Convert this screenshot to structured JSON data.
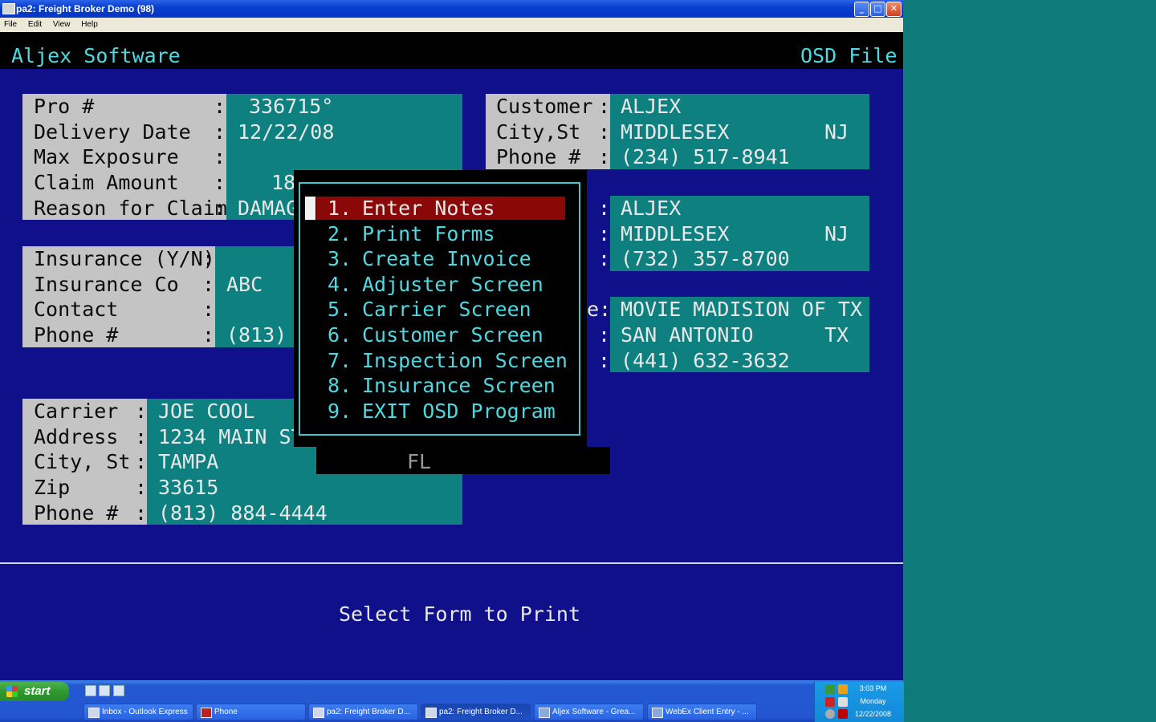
{
  "window": {
    "title": "pa2: Freight Broker Demo (98)",
    "menu": [
      "File",
      "Edit",
      "View",
      "Help"
    ],
    "minimize_glyph": "_",
    "maximize_glyph": "□",
    "close_glyph": "✕"
  },
  "header": {
    "left": "Aljex Software",
    "right": "OSD File"
  },
  "claim": {
    "labels": [
      "Pro #",
      "Delivery Date",
      "Max Exposure",
      "Claim Amount",
      "Reason for Claim"
    ],
    "values": [
      "336715°",
      "12/22/08",
      "",
      "18",
      "DAMAG"
    ]
  },
  "insurance": {
    "labels": [
      "Insurance (Y/N)",
      "Insurance Co",
      "Contact",
      "Phone #"
    ],
    "values": [
      "",
      "ABC",
      "",
      "(813)"
    ]
  },
  "carrier": {
    "labels": [
      "Carrier",
      "Address",
      "City, St",
      "Zip",
      "Phone #"
    ],
    "values": [
      "JOE COOL",
      "1234 MAIN ST",
      "TAMPA",
      "33615",
      "(813) 884-4444"
    ],
    "state": "FL"
  },
  "customer": {
    "labels": [
      "Customer",
      "City,St",
      "Phone #"
    ],
    "name": "ALJEX",
    "city": "MIDDLESEX",
    "state": "NJ",
    "phone": "(234) 517-8941"
  },
  "party2": {
    "name": "ALJEX",
    "city": "MIDDLESEX",
    "state": "NJ",
    "phone": "(732) 357-8700"
  },
  "party3": {
    "label_tail": "e:",
    "name": "MOVIE MADISION OF TX",
    "city": "SAN ANTONIO",
    "state": "TX",
    "phone": "(441) 632-3632"
  },
  "menu": {
    "items": [
      {
        "num": "1.",
        "label": "Enter Notes",
        "selected": true
      },
      {
        "num": "2.",
        "label": "Print Forms"
      },
      {
        "num": "3.",
        "label": "Create Invoice"
      },
      {
        "num": "4.",
        "label": "Adjuster Screen"
      },
      {
        "num": "5.",
        "label": "Carrier Screen"
      },
      {
        "num": "6.",
        "label": "Customer Screen"
      },
      {
        "num": "7.",
        "label": "Inspection Screen"
      },
      {
        "num": "8.",
        "label": "Insurance Screen"
      },
      {
        "num": "9.",
        "label": "EXIT OSD Program"
      }
    ]
  },
  "status_message": "Select Form to Print",
  "taskbar": {
    "start_label": "start",
    "tasks": [
      {
        "label": "Inbox - Outlook Express"
      },
      {
        "label": "Phone"
      },
      {
        "label": "pa2: Freight Broker D..."
      },
      {
        "label": "pa2: Freight Broker D...",
        "active": true
      },
      {
        "label": "Aljex Software - Grea..."
      },
      {
        "label": "WebEx Client Entry - ..."
      }
    ],
    "clock": {
      "time": "3:03 PM",
      "day": "Monday",
      "date": "12/22/2008"
    }
  },
  "colors": {
    "screen_bg": "#10108a",
    "field_bg": "#0f8080",
    "label_bg": "#c4c4c4",
    "text_cyan": "#4fd8e0",
    "menu_highlight": "#8a0808",
    "desktop": "#0f7a7a"
  }
}
